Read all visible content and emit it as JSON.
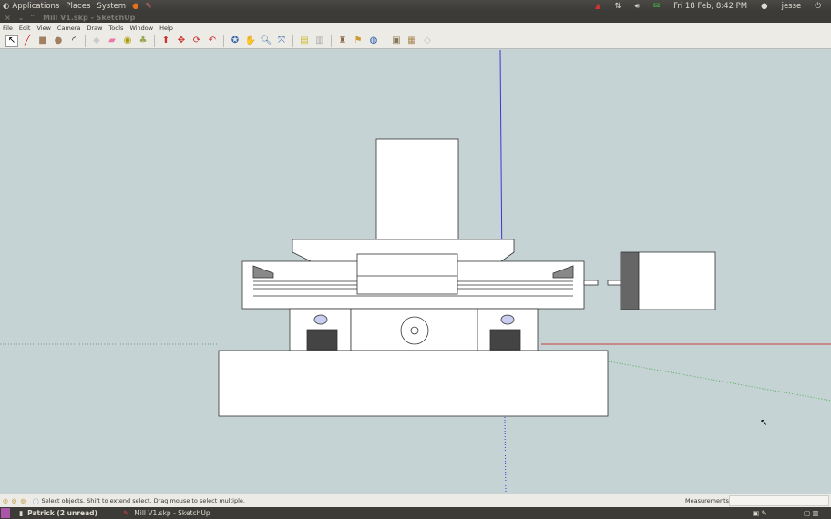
{
  "topbar": {
    "menus": [
      "Applications",
      "Places",
      "System"
    ],
    "datetime": "Fri 18 Feb, 8:42 PM",
    "user": "jesse"
  },
  "window": {
    "title": "Mill V1.skp - SketchUp"
  },
  "menubar": [
    "File",
    "Edit",
    "View",
    "Camera",
    "Draw",
    "Tools",
    "Window",
    "Help"
  ],
  "toolbar": {
    "tools": [
      "select",
      "line",
      "rectangle",
      "circle",
      "arc",
      "make-component",
      "eraser",
      "tape-measure",
      "paint-bucket",
      "push-pull",
      "move",
      "rotate",
      "follow-me",
      "orbit",
      "pan",
      "zoom",
      "zoom-extents",
      "get-models",
      "share-model",
      "place-model",
      "add-location",
      "google-earth",
      "get-photo-texture",
      "components",
      "share-component",
      "preview"
    ]
  },
  "status": {
    "hint": "Select objects. Shift to extend select. Drag mouse to select multiple.",
    "measurements_label": "Measurements",
    "measurements_value": ""
  },
  "taskbar": {
    "items": [
      "Patrick (2 unread)",
      "Mill V1.skp - SketchUp"
    ]
  },
  "colors": {
    "viewport": "#c6d3d5",
    "red_axis": "#c83c3c",
    "green_axis": "#4caf50",
    "blue_axis": "#3a3ad0"
  }
}
